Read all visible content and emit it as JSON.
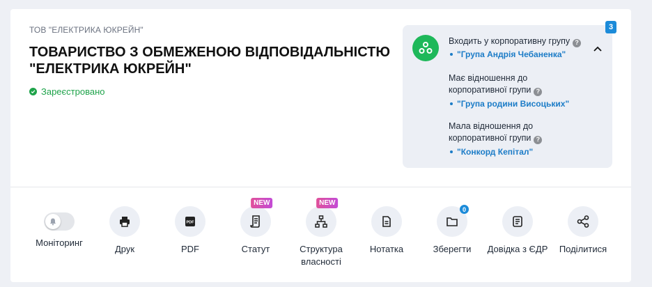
{
  "company": {
    "short_name": "ТОВ \"ЕЛЕКТРИКА ЮКРЕЙН\"",
    "full_name": "ТОВАРИСТВО З ОБМЕЖЕНОЮ ВІДПОВІДАЛЬНІСТЮ \"ЕЛЕКТРИКА ЮКРЕЙН\"",
    "status": "Зареєстровано",
    "status_color": "#1ea34a"
  },
  "groups": {
    "count": "3",
    "sections": [
      {
        "label": "Входить у корпоративну групу",
        "link": "\"Група Андрія Чебаненка\""
      },
      {
        "label": "Має відношення до корпоративної групи",
        "link": "\"Група родини Висоцьких\""
      },
      {
        "label": "Мала відношення до корпоративної групи",
        "link": "\"Конкорд Кепітал\""
      }
    ],
    "help_symbol": "?",
    "avatar_color": "#1eb85a"
  },
  "actions": [
    {
      "label": "Моніторинг",
      "icon": "bell-icon"
    },
    {
      "label": "Друк",
      "icon": "printer-icon"
    },
    {
      "label": "PDF",
      "icon": "pdf-icon"
    },
    {
      "label": "Статут",
      "icon": "scroll-icon",
      "badge": "NEW"
    },
    {
      "label": "Структура власності",
      "icon": "hierarchy-icon",
      "badge": "NEW"
    },
    {
      "label": "Нотатка",
      "icon": "note-icon"
    },
    {
      "label": "Зберегти",
      "icon": "folder-icon",
      "count": "0"
    },
    {
      "label": "Довідка з ЄДР",
      "icon": "document-icon"
    },
    {
      "label": "Поділитися",
      "icon": "share-icon"
    }
  ],
  "colors": {
    "accent": "#1c8bd9",
    "link": "#1c7cc7",
    "new_badge": "#d84fb5"
  }
}
